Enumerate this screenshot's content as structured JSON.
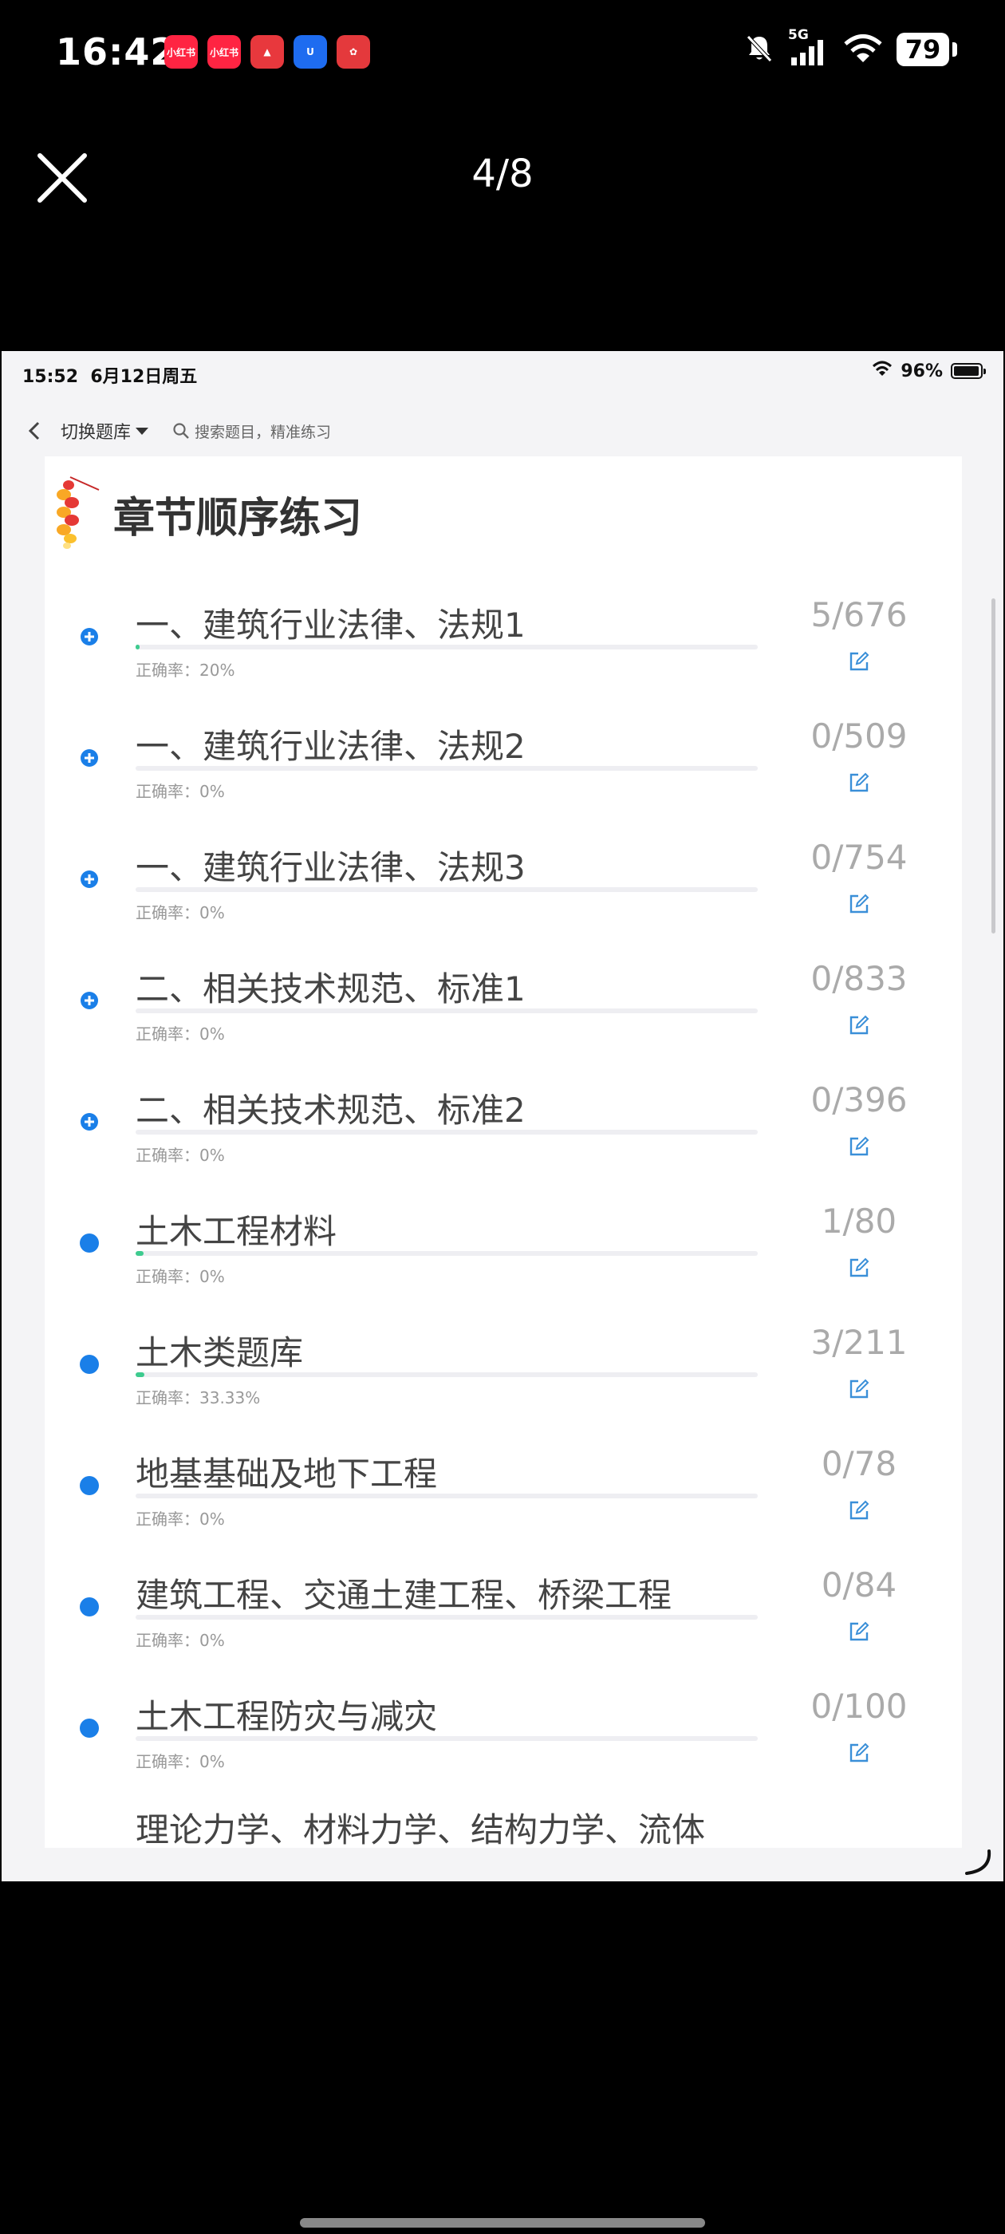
{
  "phone_status": {
    "time": "16:42",
    "apps": [
      {
        "icon": "xiaohongshu-icon",
        "label": "小红书",
        "color": "#ff2442"
      },
      {
        "icon": "xiaohongshu-icon",
        "label": "小红书",
        "color": "#ff2442"
      },
      {
        "icon": "triangle-app-icon",
        "label": "▲",
        "color": "#e8383d"
      },
      {
        "icon": "blue-app-icon",
        "label": "U",
        "color": "#1e6cf0"
      },
      {
        "icon": "pink-app-icon",
        "label": "✿",
        "color": "#e4393c"
      }
    ],
    "network": "5G",
    "battery": "79"
  },
  "viewer": {
    "counter": "4/8"
  },
  "ipad_status": {
    "time": "15:52",
    "date": "6月12日周五",
    "battery": "96%"
  },
  "toolbar": {
    "switch_label": "切换题库",
    "search_placeholder": "搜索题目，精准练习"
  },
  "section": {
    "title": "章节顺序练习"
  },
  "chapters": [
    {
      "name": "一、建筑行业法律、法规1",
      "count": "5/676",
      "rate": "正确率：20%",
      "progress": 0.007,
      "expandable": true
    },
    {
      "name": "一、建筑行业法律、法规2",
      "count": "0/509",
      "rate": "正确率：0%",
      "progress": 0,
      "expandable": true
    },
    {
      "name": "一、建筑行业法律、法规3",
      "count": "0/754",
      "rate": "正确率：0%",
      "progress": 0,
      "expandable": true
    },
    {
      "name": "二、相关技术规范、标准1",
      "count": "0/833",
      "rate": "正确率：0%",
      "progress": 0,
      "expandable": true
    },
    {
      "name": "二、相关技术规范、标准2",
      "count": "0/396",
      "rate": "正确率：0%",
      "progress": 0,
      "expandable": true
    },
    {
      "name": "土木工程材料",
      "count": "1/80",
      "rate": "正确率：0%",
      "progress": 0.0125,
      "expandable": false
    },
    {
      "name": "土木类题库",
      "count": "3/211",
      "rate": "正确率：33.33%",
      "progress": 0.014,
      "expandable": false
    },
    {
      "name": "地基基础及地下工程",
      "count": "0/78",
      "rate": "正确率：0%",
      "progress": 0,
      "expandable": false
    },
    {
      "name": "建筑工程、交通土建工程、桥梁工程",
      "count": "0/84",
      "rate": "正确率：0%",
      "progress": 0,
      "expandable": false
    },
    {
      "name": "土木工程防灾与减灾",
      "count": "0/100",
      "rate": "正确率：0%",
      "progress": 0,
      "expandable": false
    }
  ],
  "cut_off_chapter": {
    "name": "理论力学、材料力学、结构力学、流体"
  },
  "colors": {
    "accent_blue": "#1a7fe8",
    "progress_green": "#3ecb8f",
    "edit_blue": "#3a8fd8"
  }
}
